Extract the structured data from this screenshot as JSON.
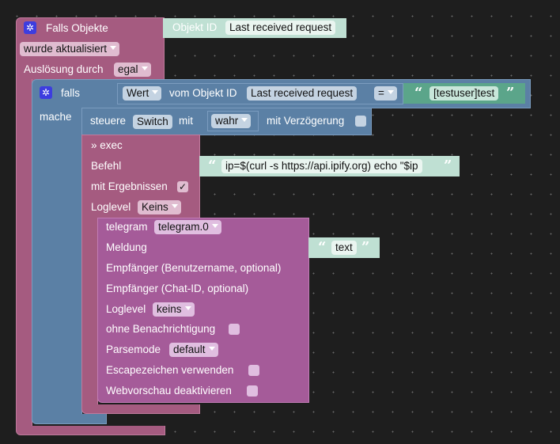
{
  "trigger": {
    "title": "Falls Objekte",
    "event": "wurde aktualisiert",
    "by_label": "Auslösung durch",
    "by_value": "egal",
    "object_label": "Objekt ID",
    "object_value": "Last received request"
  },
  "if_block": {
    "label": "falls",
    "do_label": "mache",
    "value_type": "Wert",
    "object_label": "vom Objekt ID",
    "object_value": "Last received request",
    "operator": "=",
    "quote_open": "“",
    "quote_close": "”",
    "compare_value": "[testuser]test"
  },
  "control": {
    "label": "steuere",
    "target": "Switch",
    "with_label": "mit",
    "value": "wahr",
    "delay_label": "mit Verzögerung"
  },
  "exec": {
    "title": "» exec",
    "command_label": "Befehl",
    "command": "ip=$(curl -s https://api.ipify.org) echo \"$ip",
    "results_label": "mit Ergebnissen",
    "results_check": "✓",
    "loglevel_label": "Loglevel",
    "loglevel": "Keins"
  },
  "telegram": {
    "label": "telegram",
    "instance": "telegram.0",
    "message_label": "Meldung",
    "message": "text",
    "user_label": "Empfänger (Benutzername, optional)",
    "chat_label": "Empfänger (Chat-ID, optional)",
    "loglevel_label": "Loglevel",
    "loglevel": "keins",
    "silent_label": "ohne Benachrichtigung",
    "parse_label": "Parsemode",
    "parse": "default",
    "escape_label": "Escapezeichen verwenden",
    "preview_label": "Webvorschau deaktivieren"
  },
  "colors": {
    "trigger": "#a55b80",
    "logic": "#5b80a5",
    "telegram": "#a55b99",
    "text": "#bfe0d3",
    "compare": "#5ba58a"
  }
}
